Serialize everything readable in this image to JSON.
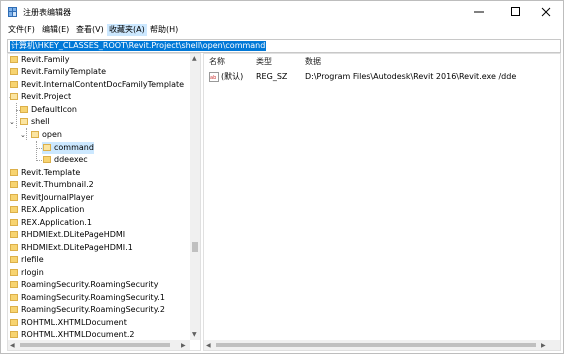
{
  "window": {
    "title": "注册表编辑器"
  },
  "menu": [
    {
      "label": "文件(F)"
    },
    {
      "label": "编辑(E)"
    },
    {
      "label": "查看(V)"
    },
    {
      "label": "收藏夹(A)"
    },
    {
      "label": "帮助(H)"
    }
  ],
  "address": "计算机\\HKEY_CLASSES_ROOT\\Revit.Project\\shell\\open\\command",
  "tree": [
    {
      "label": "Revit.Family"
    },
    {
      "label": "Revit.FamilyTemplate"
    },
    {
      "label": "Revit.InternalContentDocFamilyTemplate"
    },
    {
      "label": "Revit.Project"
    },
    {
      "label": "DefaultIcon"
    },
    {
      "label": "shell"
    },
    {
      "label": "open"
    },
    {
      "label": "command"
    },
    {
      "label": "ddeexec"
    },
    {
      "label": "Revit.Template"
    },
    {
      "label": "Revit.Thumbnail.2"
    },
    {
      "label": "RevitJournalPlayer"
    },
    {
      "label": "REX.Application"
    },
    {
      "label": "REX.Application.1"
    },
    {
      "label": "RHDMIExt.DLitePageHDMI"
    },
    {
      "label": "RHDMIExt.DLitePageHDMI.1"
    },
    {
      "label": "rlefile"
    },
    {
      "label": "rlogin"
    },
    {
      "label": "RoamingSecurity.RoamingSecurity"
    },
    {
      "label": "RoamingSecurity.RoamingSecurity.1"
    },
    {
      "label": "RoamingSecurity.RoamingSecurity.2"
    },
    {
      "label": "ROHTML.XHTMLDocument"
    },
    {
      "label": "ROHTML.XHTMLDocument.2"
    }
  ],
  "list": {
    "headers": {
      "name": "名称",
      "type": "类型",
      "data": "数据"
    },
    "rows": [
      {
        "name": "(默认)",
        "type": "REG_SZ",
        "data": "D:\\Program Files\\Autodesk\\Revit 2016\\Revit.exe /dde"
      }
    ]
  },
  "colors": {
    "accent": "#0078d7",
    "selection": "#cce8ff",
    "folder": "#f7d471"
  }
}
